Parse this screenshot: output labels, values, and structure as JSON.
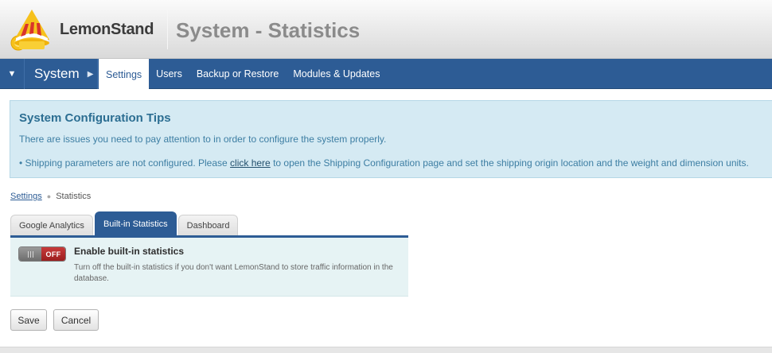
{
  "header": {
    "logo_text": "LemonStand",
    "page_title": "System - Statistics"
  },
  "nav": {
    "section": "System",
    "items": [
      {
        "label": "Settings",
        "active": true
      },
      {
        "label": "Users",
        "active": false
      },
      {
        "label": "Backup or Restore",
        "active": false
      },
      {
        "label": "Modules & Updates",
        "active": false
      }
    ]
  },
  "tips": {
    "title": "System Configuration Tips",
    "intro": "There are issues you need to pay attention to in order to configure the system properly.",
    "item_prefix": "Shipping parameters are not configured. Please ",
    "item_link": "click here",
    "item_suffix": " to open the Shipping Configuration page and set the shipping origin location and the weight and dimension units."
  },
  "breadcrumb": {
    "parent": "Settings",
    "current": "Statistics"
  },
  "tabs": [
    {
      "label": "Google Analytics",
      "active": false
    },
    {
      "label": "Built-in Statistics",
      "active": true
    },
    {
      "label": "Dashboard",
      "active": false
    }
  ],
  "setting": {
    "toggle_state": "OFF",
    "title": "Enable built-in statistics",
    "description": "Turn off the built-in statistics if you don't want LemonStand to store traffic information in the database."
  },
  "buttons": {
    "save": "Save",
    "cancel": "Cancel"
  },
  "colors": {
    "nav_blue": "#2d5c95",
    "tips_bg": "#d5eaf3",
    "toggle_off_red": "#b52a2a"
  }
}
